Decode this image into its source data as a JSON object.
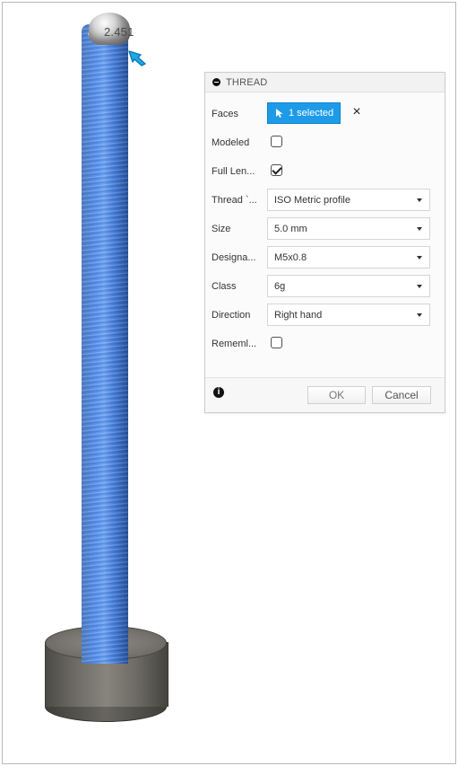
{
  "viewport": {
    "dimension_text": "2.451"
  },
  "dialog": {
    "title": "THREAD",
    "rows": [
      {
        "label": "Faces",
        "type": "selection",
        "value": "1 selected",
        "clear_symbol": "×"
      },
      {
        "label": "Modeled",
        "type": "checkbox",
        "checked": false
      },
      {
        "label": "Full Len...",
        "type": "checkbox",
        "checked": true
      },
      {
        "label": "Thread `...",
        "type": "select",
        "value": "ISO Metric profile"
      },
      {
        "label": "Size",
        "type": "select",
        "value": "5.0 mm"
      },
      {
        "label": "Designa...",
        "type": "select",
        "value": "M5x0.8"
      },
      {
        "label": "Class",
        "type": "select",
        "value": "6g"
      },
      {
        "label": "Direction",
        "type": "select",
        "value": "Right hand"
      },
      {
        "label": "Rememl...",
        "type": "checkbox",
        "checked": false
      }
    ],
    "footer": {
      "info_symbol": "i",
      "ok_label": "OK",
      "cancel_label": "Cancel"
    }
  },
  "colors": {
    "thread_blue": "#3f7fe0",
    "selection_blue": "#1e9be8",
    "base_gray": "#6f6d66"
  },
  "icons": {
    "collapse": "collapse-icon",
    "cursor": "cursor-icon",
    "dropdown": "dropdown-icon",
    "info": "info-icon",
    "manipulator": "arrow-handle"
  }
}
